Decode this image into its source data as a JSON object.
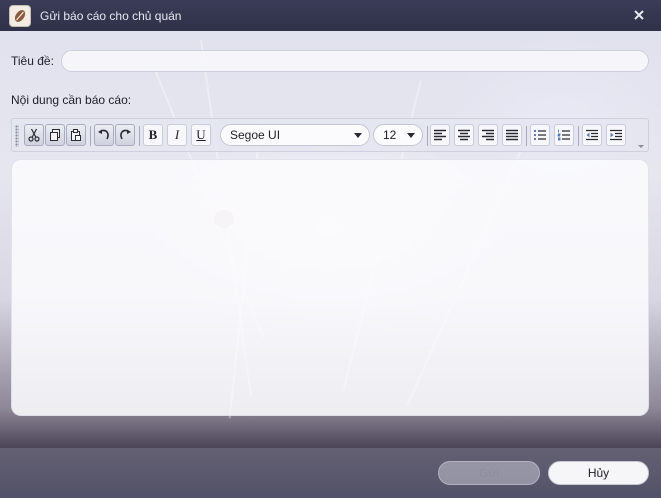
{
  "window": {
    "title": "Gửi báo cáo cho chủ quán",
    "close_icon": "close-icon",
    "app_icon": "coffee-bean-icon"
  },
  "form": {
    "subject_label": "Tiêu đề:",
    "subject_value": "",
    "content_label": "Nội dung cần báo cáo:",
    "content_value": ""
  },
  "toolbar": {
    "buttons": [
      {
        "name": "cut",
        "icon": "scissors-icon"
      },
      {
        "name": "copy",
        "icon": "copy-icon"
      },
      {
        "name": "paste",
        "icon": "paste-icon"
      },
      {
        "name": "undo",
        "icon": "undo-icon"
      },
      {
        "name": "redo",
        "icon": "redo-icon"
      },
      {
        "name": "bold",
        "label": "B"
      },
      {
        "name": "italic",
        "label": "I"
      },
      {
        "name": "underline",
        "label": "U"
      },
      {
        "name": "align-left",
        "icon": "align-left-icon"
      },
      {
        "name": "align-center",
        "icon": "align-center-icon"
      },
      {
        "name": "align-right",
        "icon": "align-right-icon"
      },
      {
        "name": "justify",
        "icon": "justify-icon"
      },
      {
        "name": "bullets",
        "icon": "bullet-list-icon"
      },
      {
        "name": "numbering",
        "icon": "numbered-list-icon"
      },
      {
        "name": "decrease-indent",
        "icon": "outdent-icon"
      },
      {
        "name": "increase-indent",
        "icon": "indent-icon"
      }
    ],
    "font_family": "Segoe UI",
    "font_size": "12"
  },
  "footer": {
    "send_label": "Gửi",
    "send_enabled": false,
    "cancel_label": "Hủy"
  },
  "colors": {
    "titlebar": "#2f3148",
    "title_text": "#e8e8f2",
    "disabled_text": "#8f8e9c"
  }
}
